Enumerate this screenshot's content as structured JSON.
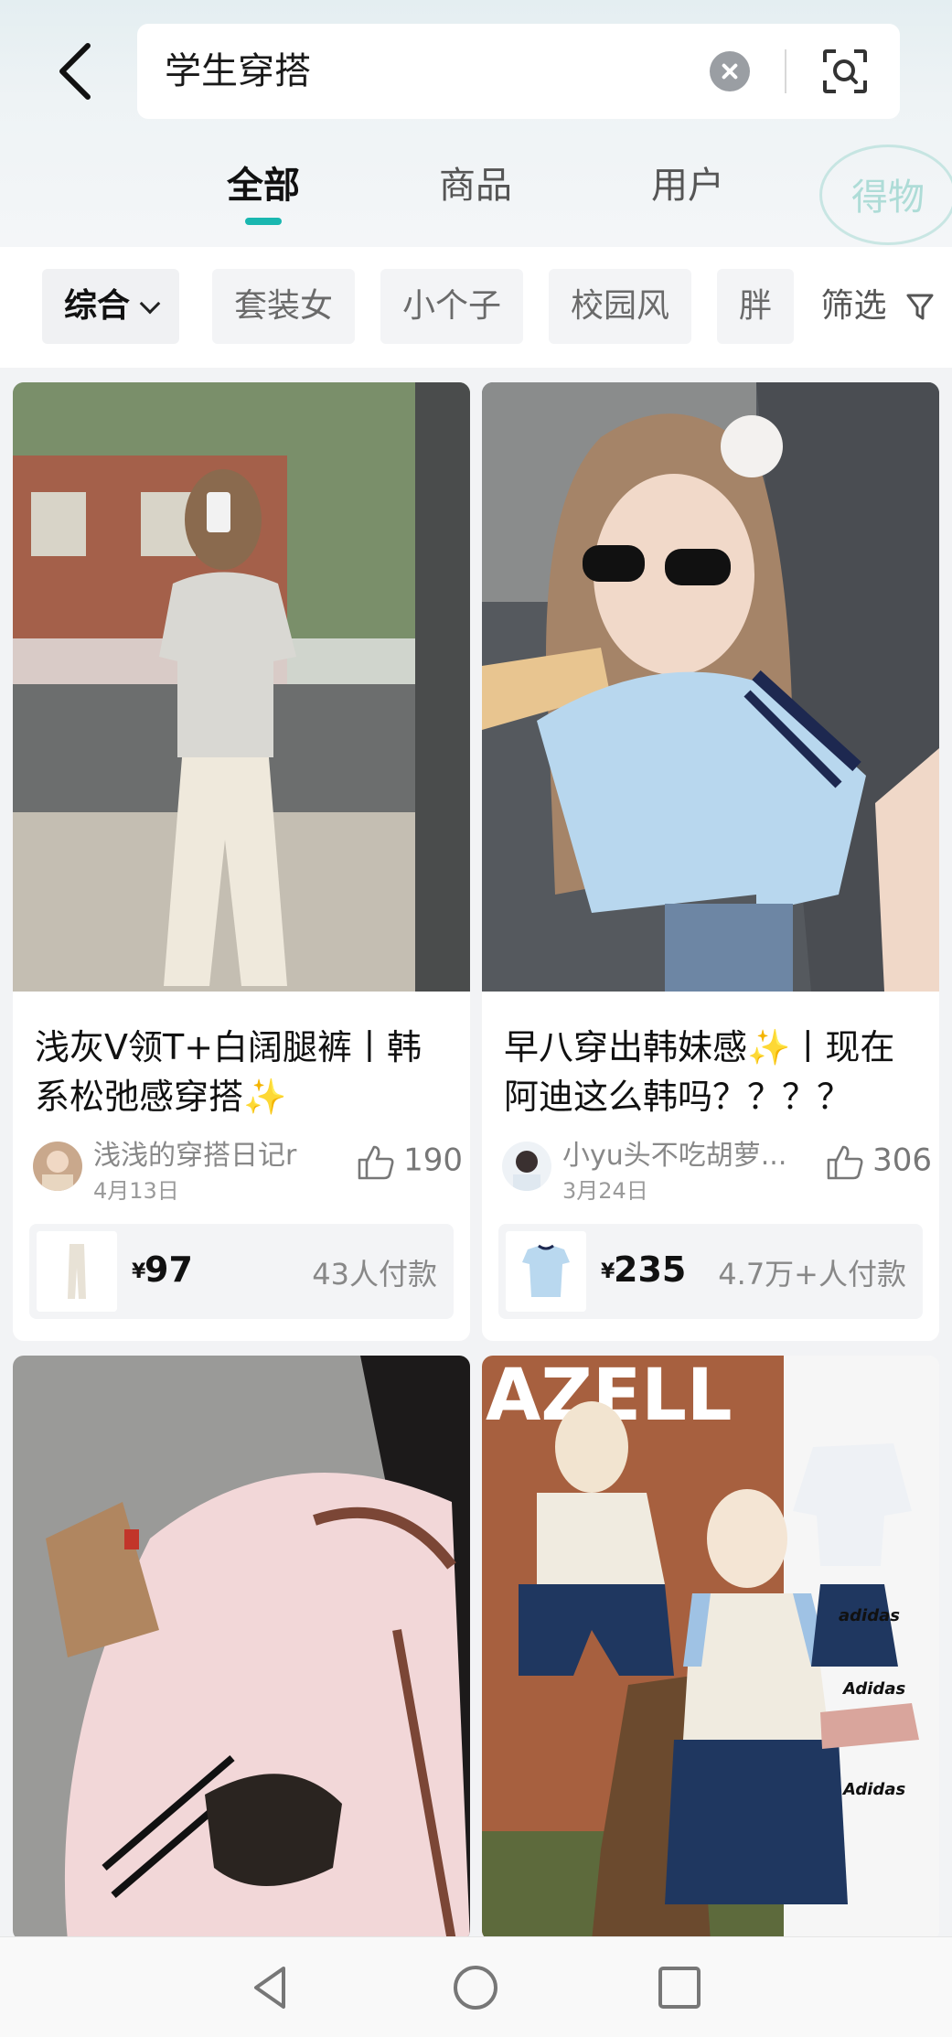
{
  "search": {
    "query": "学生穿搭"
  },
  "tabs": [
    {
      "label": "全部",
      "active": true
    },
    {
      "label": "商品",
      "active": false
    },
    {
      "label": "用户",
      "active": false
    }
  ],
  "watermark": "得物",
  "filters": {
    "sort_label": "综合",
    "chips": [
      "套装女",
      "小个子",
      "校园风",
      "胖"
    ],
    "filter_label": "筛选"
  },
  "cards": [
    {
      "title": "浅灰V领T+白阔腿裤丨韩系松弛感穿搭✨",
      "author": "浅浅的穿搭日记r",
      "date": "4月13日",
      "likes": "190",
      "price_symbol": "¥",
      "price": "97",
      "paid": "43人付款"
    },
    {
      "title": "早八穿出韩妹感✨丨现在阿迪这么韩吗？？？？",
      "author": "小yu头不吃胡萝...",
      "date": "3月24日",
      "likes": "306",
      "price_symbol": "¥",
      "price": "235",
      "paid": "4.7万+人付款"
    }
  ],
  "image_text": {
    "brand_banner": "AZELL",
    "adidas_labels": [
      "adidas",
      "Adidas",
      "Adidas"
    ]
  },
  "colors": {
    "accent": "#19b7b0",
    "header_bg": "#e4eef1",
    "page_bg": "#f2f3f5"
  },
  "nav": {
    "back_icon": "triangle-back-icon",
    "home_icon": "circle-home-icon",
    "recents_icon": "square-recents-icon"
  }
}
